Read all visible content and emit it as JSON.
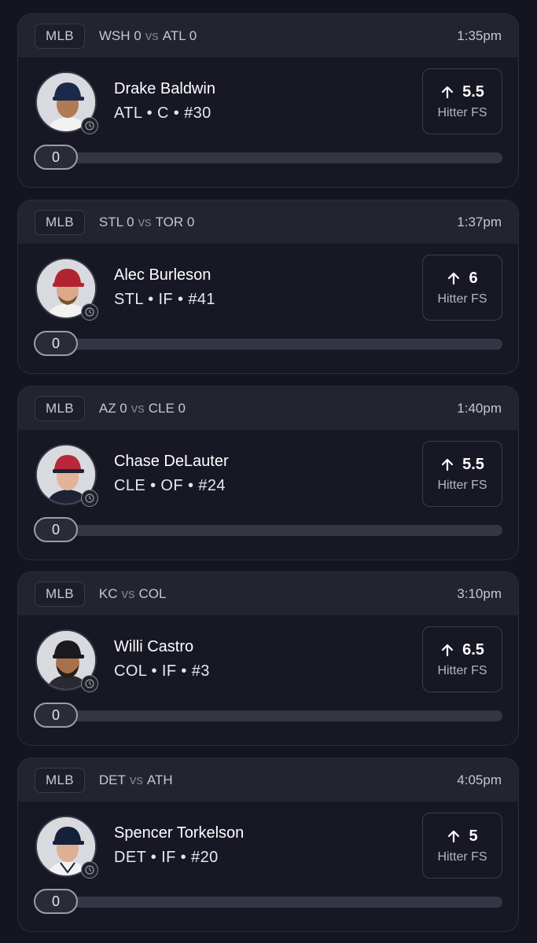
{
  "cards": [
    {
      "league": "MLB",
      "away_team": "WSH 0",
      "vs": "vs",
      "home_team": "ATL 0",
      "time": "1:35pm",
      "player_name": "Drake Baldwin",
      "player_meta": "ATL • C • #30",
      "projection": "5.5",
      "stat_label": "Hitter FS",
      "current_value": "0",
      "progress": 0,
      "cap_color": "#1b2a4a"
    },
    {
      "league": "MLB",
      "away_team": "STL 0",
      "vs": "vs",
      "home_team": "TOR 0",
      "time": "1:37pm",
      "player_name": "Alec Burleson",
      "player_meta": "STL • IF • #41",
      "projection": "6",
      "stat_label": "Hitter FS",
      "current_value": "0",
      "progress": 0,
      "cap_color": "#b3232f"
    },
    {
      "league": "MLB",
      "away_team": "AZ 0",
      "vs": "vs",
      "home_team": "CLE 0",
      "time": "1:40pm",
      "player_name": "Chase DeLauter",
      "player_meta": "CLE • OF • #24",
      "projection": "5.5",
      "stat_label": "Hitter FS",
      "current_value": "0",
      "progress": 0,
      "cap_color": "#b8283a"
    },
    {
      "league": "MLB",
      "away_team": "KC",
      "vs": "vs",
      "home_team": "COL",
      "time": "3:10pm",
      "player_name": "Willi Castro",
      "player_meta": "COL • IF • #3",
      "projection": "6.5",
      "stat_label": "Hitter FS",
      "current_value": "0",
      "progress": 0,
      "cap_color": "#1a1a1f"
    },
    {
      "league": "MLB",
      "away_team": "DET",
      "vs": "vs",
      "home_team": "ATH",
      "time": "4:05pm",
      "player_name": "Spencer Torkelson",
      "player_meta": "DET • IF • #20",
      "projection": "5",
      "stat_label": "Hitter FS",
      "current_value": "0",
      "progress": 0,
      "cap_color": "#15213a"
    }
  ],
  "icons": {
    "projection_direction": "arrow-up-icon",
    "avatar_status": "clock-icon"
  }
}
